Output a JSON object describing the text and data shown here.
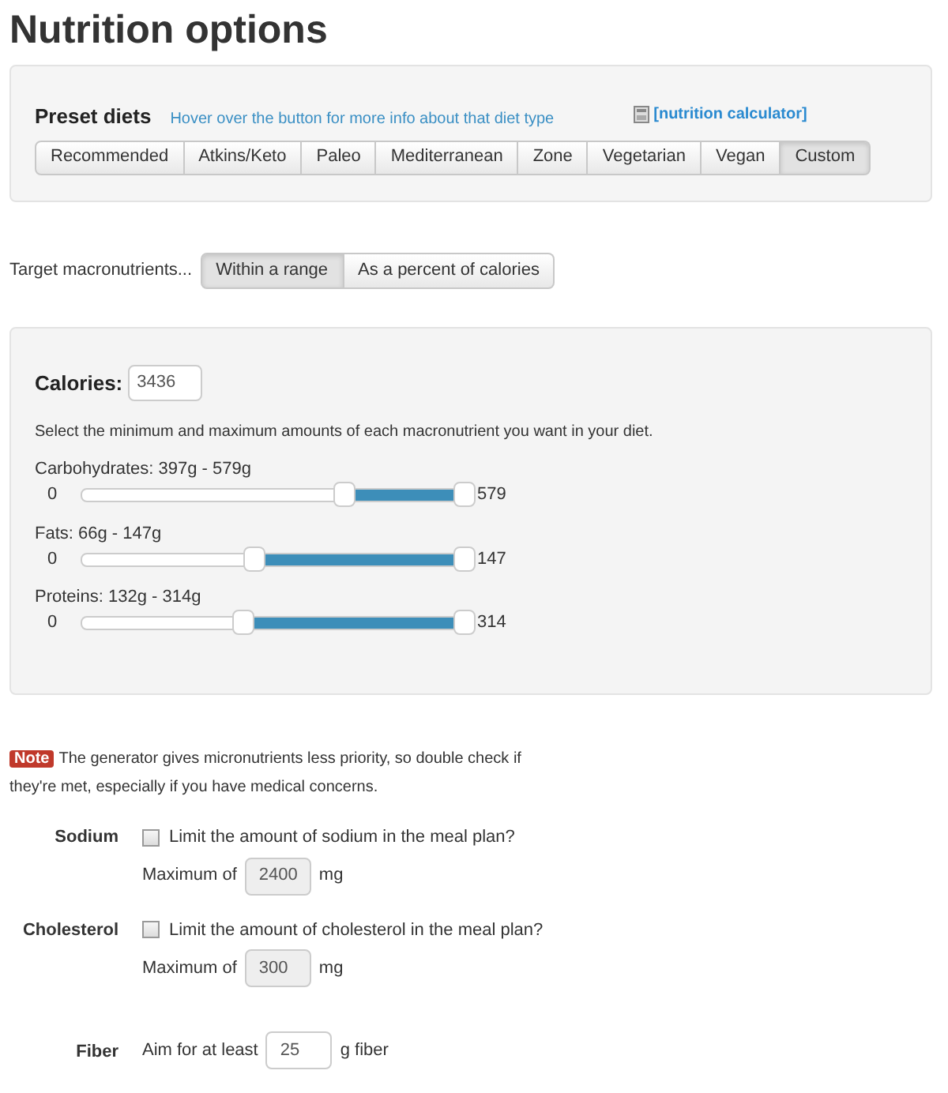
{
  "title": "Nutrition options",
  "preset": {
    "heading": "Preset diets",
    "hint": "Hover over the button for more info about that diet type",
    "calculator_link": "[nutrition calculator]",
    "diets": [
      {
        "label": "Recommended",
        "selected": false
      },
      {
        "label": "Atkins/Keto",
        "selected": false
      },
      {
        "label": "Paleo",
        "selected": false
      },
      {
        "label": "Mediterranean",
        "selected": false
      },
      {
        "label": "Zone",
        "selected": false
      },
      {
        "label": "Vegetarian",
        "selected": false
      },
      {
        "label": "Vegan",
        "selected": false
      },
      {
        "label": "Custom",
        "selected": true
      }
    ]
  },
  "target": {
    "label": "Target macronutrients...",
    "modes": [
      {
        "label": "Within a range",
        "selected": true
      },
      {
        "label": "As a percent of calories",
        "selected": false
      }
    ]
  },
  "macros": {
    "calories_label": "Calories:",
    "calories_value": "3436",
    "instructions": "Select the minimum and maximum amounts of each macronutrient you want in your diet.",
    "sliders": [
      {
        "label": "Carbohydrates: 397g - 579g",
        "min": "0",
        "max": "579"
      },
      {
        "label": "Fats: 66g - 147g",
        "min": "0",
        "max": "147"
      },
      {
        "label": "Proteins: 132g - 314g",
        "min": "0",
        "max": "314"
      }
    ]
  },
  "note": {
    "badge": "Note",
    "text": "The generator gives micronutrients less priority, so double check if they're met, especially if you have medical concerns."
  },
  "limits": [
    {
      "kind": "checkbox",
      "name": "Sodium",
      "question": "Limit the amount of sodium in the meal plan?",
      "checked": false,
      "prefix": "Maximum of",
      "value": "2400",
      "unit": "mg"
    },
    {
      "kind": "checkbox",
      "name": "Cholesterol",
      "question": "Limit the amount of cholesterol in the meal plan?",
      "checked": false,
      "prefix": "Maximum of",
      "value": "300",
      "unit": "mg"
    },
    {
      "kind": "target",
      "name": "Fiber",
      "prefix": "Aim for at least",
      "value": "25",
      "unit": "g fiber"
    }
  ]
}
